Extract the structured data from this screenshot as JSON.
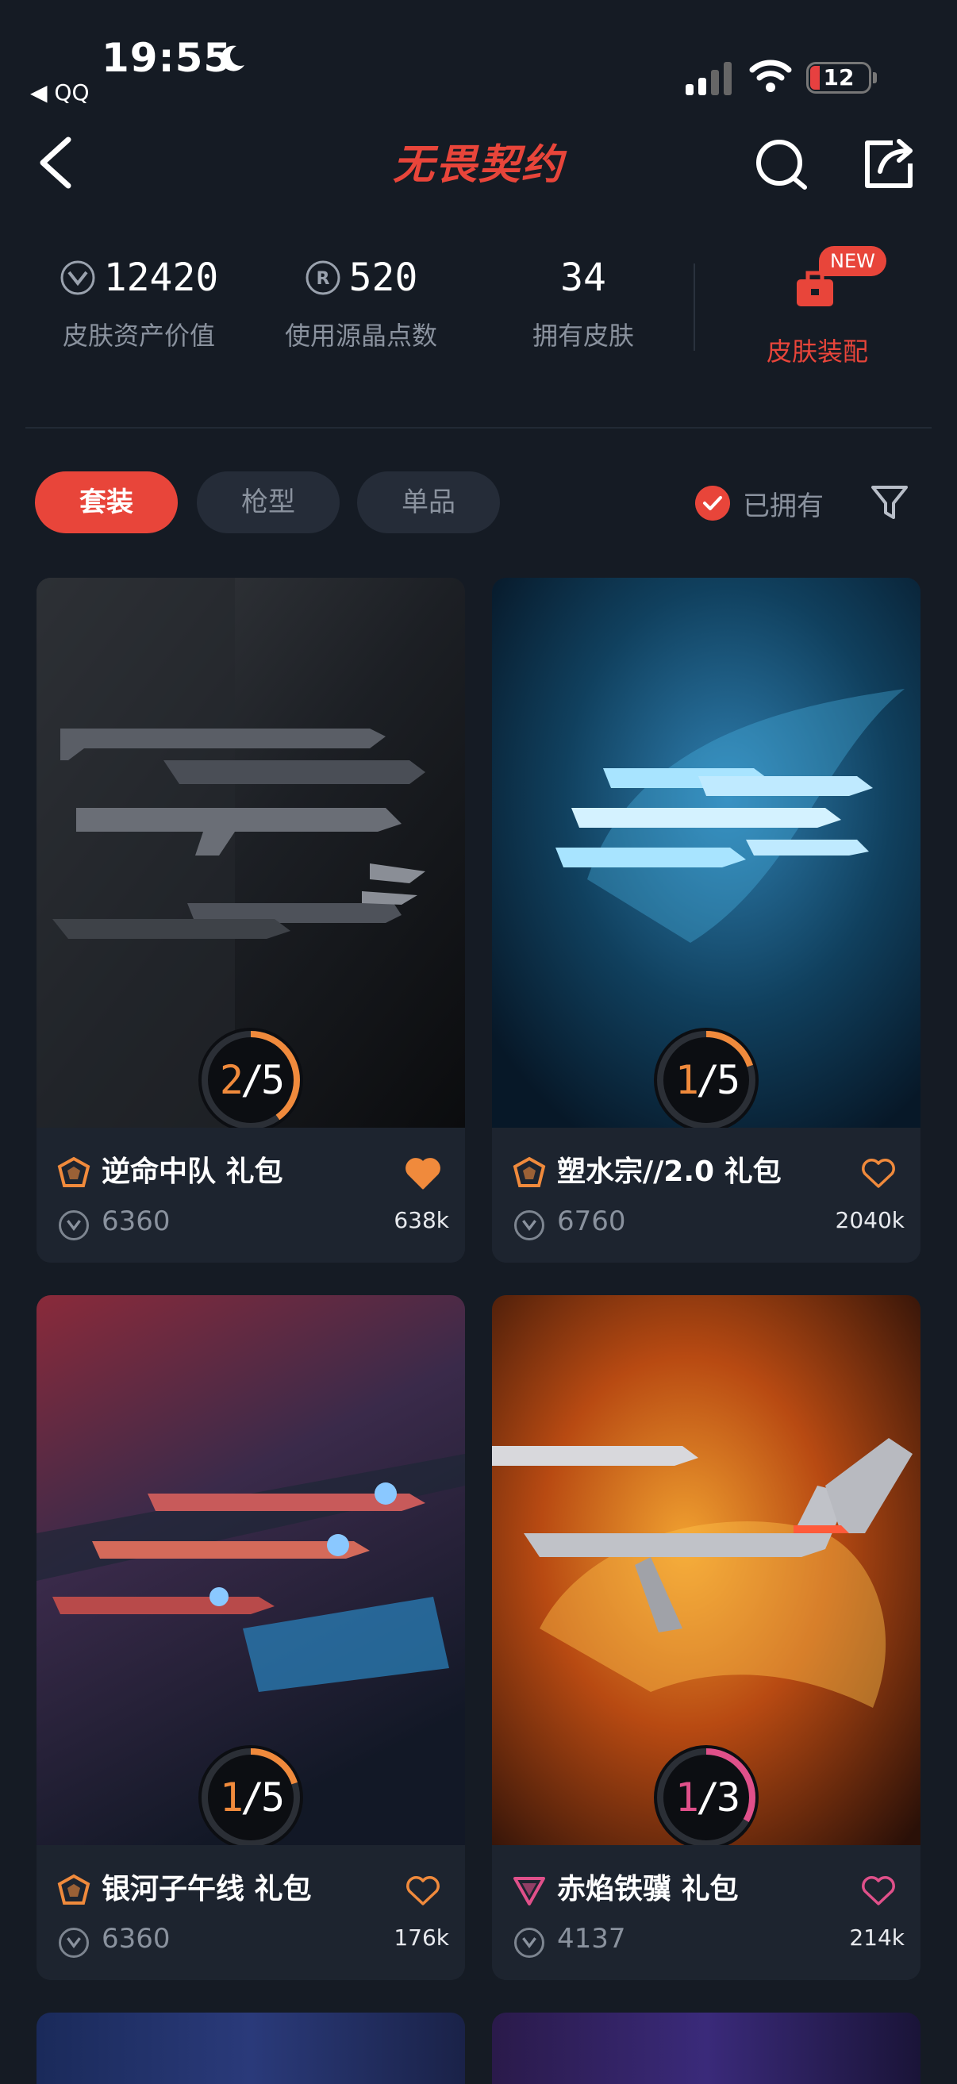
{
  "status": {
    "time": "19:55",
    "back_app": "◀ QQ",
    "battery": "12"
  },
  "nav": {
    "title": "无畏契约"
  },
  "stats": [
    {
      "value": "12420",
      "label": "皮肤资产价值",
      "icon": "vp-icon"
    },
    {
      "value": "520",
      "label": "使用源晶点数",
      "icon": "radianite-icon"
    },
    {
      "value": "34",
      "label": "拥有皮肤",
      "icon": ""
    }
  ],
  "outfit": {
    "badge": "NEW",
    "label": "皮肤装配"
  },
  "filters": {
    "tabs": [
      "套装",
      "枪型",
      "单品"
    ],
    "active": 0,
    "owned_label": "已拥有"
  },
  "colors": {
    "accent": "#e8453a",
    "orange": "#f08a3c",
    "pink": "#e0508a",
    "bg": "#151b24",
    "card": "#1d242f"
  },
  "cards": [
    {
      "name": "逆命中队 礼包",
      "price": "6360",
      "likes": "638k",
      "progress_owned": "2",
      "progress_total": "5",
      "progress": 0.4,
      "tier_color": "#f08a3c",
      "heart_filled": true
    },
    {
      "name": "塑水宗//2.0 礼包",
      "price": "6760",
      "likes": "2040k",
      "progress_owned": "1",
      "progress_total": "5",
      "progress": 0.2,
      "tier_color": "#f08a3c",
      "heart_filled": false
    },
    {
      "name": "银河子午线 礼包",
      "price": "6360",
      "likes": "176k",
      "progress_owned": "1",
      "progress_total": "5",
      "progress": 0.2,
      "tier_color": "#f08a3c",
      "heart_filled": false
    },
    {
      "name": "赤焰铁骥 礼包",
      "price": "4137",
      "likes": "214k",
      "progress_owned": "1",
      "progress_total": "3",
      "progress": 0.333,
      "tier_color": "#e0508a",
      "heart_filled": false
    }
  ]
}
